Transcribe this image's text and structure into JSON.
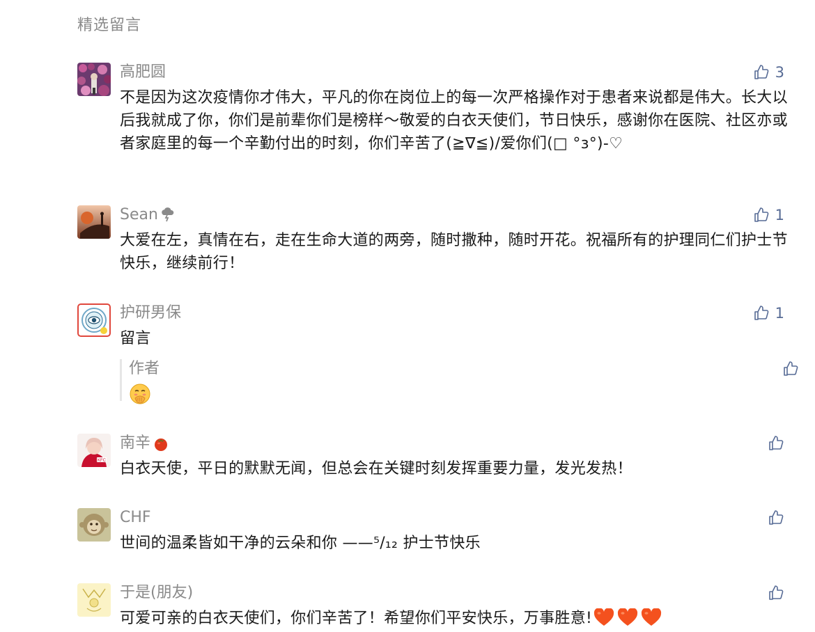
{
  "section_title": "精选留言",
  "comments": [
    {
      "nickname": "高肥圆",
      "content": "不是因为这次疫情你才伟大，平凡的你在岗位上的每一次严格操作对于患者来说都是伟大。长大以后我就成了你，你们是前辈你们是榜样～敬爱的白衣天使们，节日快乐，感谢你在医院、社区亦或者家庭里的每一个辛勤付出的时刻，你们辛苦了(≧∇≦)/爱你们(□ °ɜ°)-♡",
      "likes": "3",
      "avatar_icon": "avatar-flowers"
    },
    {
      "nickname": "Sean",
      "nickname_icon": "storm-cloud-icon",
      "content": "大爱在左，真情在右，走在生命大道的两旁，随时撒种，随时开花。祝福所有的护理同仁们护士节快乐，继续前行！",
      "likes": "1",
      "avatar_icon": "avatar-sunset-rider"
    },
    {
      "nickname": "护研男保",
      "content": "留言",
      "likes": "1",
      "avatar_icon": "avatar-eye-badge",
      "reply": {
        "author": "作者",
        "emoji": "face-with-hand-over-mouth-emoji"
      }
    },
    {
      "nickname": "南辛",
      "nickname_icon": "tomato-emoji",
      "content": "白衣天使，平日的默默无闻，但总会在关键时刻发挥重要力量，发光发热！",
      "likes": "",
      "avatar_icon": "avatar-kfc-girl"
    },
    {
      "nickname": "CHF",
      "content": "世间的温柔皆如干净的云朵和你 ——⁵/₁₂  护士节快乐",
      "likes": "",
      "avatar_icon": "avatar-monkey"
    },
    {
      "nickname": "于是(朋友)",
      "content": "可爱可亲的白衣天使们，你们辛苦了！希望你们平安快乐，万事胜意!",
      "content_suffix_icons": [
        "orange-heart-emoji",
        "orange-heart-emoji",
        "orange-heart-emoji"
      ],
      "likes": "",
      "avatar_icon": "avatar-yellow-doodle"
    }
  ],
  "colors": {
    "link": "#576b95",
    "meta": "#8a8a8a",
    "text": "#1a1a1a",
    "heart": "#f4511e"
  }
}
